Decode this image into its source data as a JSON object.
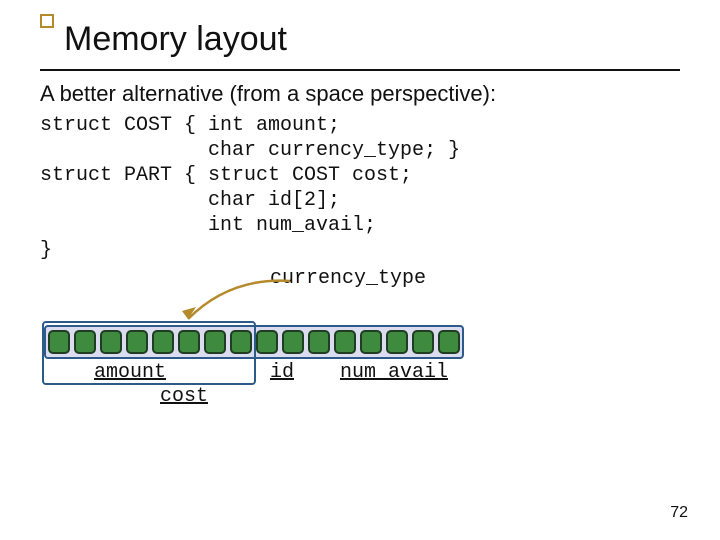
{
  "title": "Memory layout",
  "lead": "A better alternative (from a space perspective):",
  "code": "struct COST { int amount;\n              char currency_type; }\nstruct PART { struct COST cost;\n              char id[2];\n              int num_avail;\n}",
  "labels": {
    "currency_type": "currency_type",
    "amount": "amount",
    "id": "id",
    "num_avail": "num_avail",
    "cost": "cost"
  },
  "page_number": "72",
  "byte_count": 16,
  "colors": {
    "accent_border": "#b58a2b",
    "mem_border": "#2c5a8a",
    "mem_fill": "#dcdcf0",
    "byte_fill": "#3e8a3e"
  }
}
